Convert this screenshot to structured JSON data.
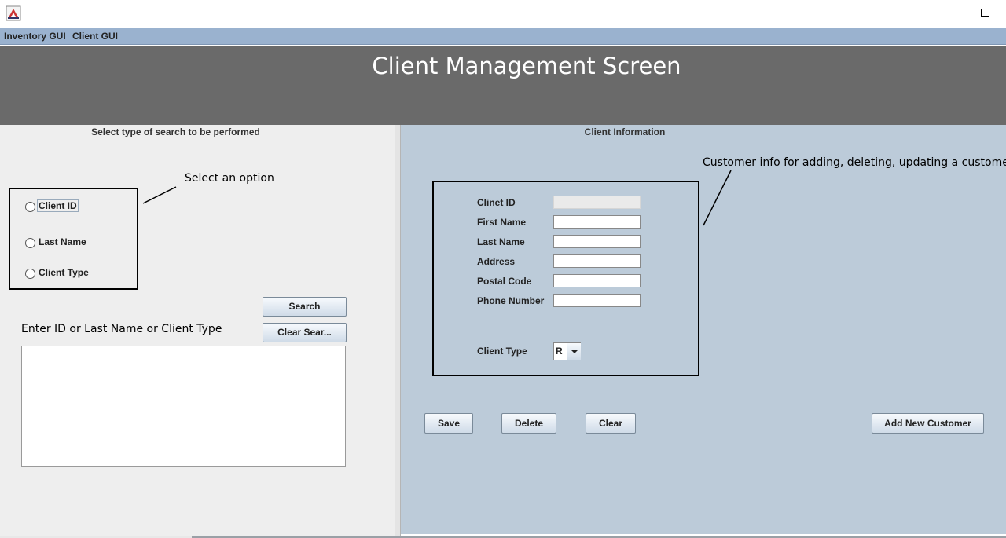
{
  "menubar": {
    "items": [
      {
        "label": "Inventory GUI"
      },
      {
        "label": "Client GUI"
      }
    ]
  },
  "header": {
    "title": "Client Management Screen"
  },
  "left": {
    "heading": "Select type of search to be performed",
    "annotation": "Select an option",
    "radios": [
      {
        "label": "Client ID",
        "selected": false
      },
      {
        "label": "Last Name",
        "selected": false
      },
      {
        "label": "Client Type",
        "selected": false
      }
    ],
    "search_button": "Search",
    "clear_search_button": "Clear Sear...",
    "search_input": {
      "value": "Enter ID or Last Name or Client Type"
    }
  },
  "right": {
    "heading": "Client Information",
    "annotation": "Customer info for adding, deleting, updating a customer",
    "fields": [
      {
        "label": "Clinet ID",
        "value": ""
      },
      {
        "label": "First Name",
        "value": ""
      },
      {
        "label": "Last Name",
        "value": ""
      },
      {
        "label": "Address",
        "value": ""
      },
      {
        "label": "Postal Code",
        "value": ""
      },
      {
        "label": "Phone Number",
        "value": ""
      }
    ],
    "client_type": {
      "label": "Client Type",
      "value": "R"
    },
    "buttons": {
      "save": "Save",
      "delete": "Delete",
      "clear": "Clear",
      "add_new": "Add New Customer"
    }
  }
}
